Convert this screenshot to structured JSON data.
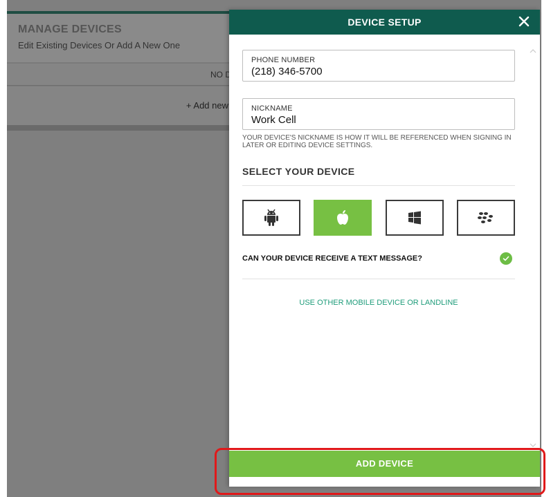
{
  "background": {
    "title": "MANAGE DEVICES",
    "subtitle": "Edit Existing Devices Or Add A New One",
    "no_devices_text": "NO D",
    "add_new_text": "+ Add new"
  },
  "modal": {
    "title": "DEVICE SETUP",
    "close_icon": "close-icon",
    "phone": {
      "label": "PHONE NUMBER",
      "value": "(218) 346-5700"
    },
    "nickname": {
      "label": "NICKNAME",
      "value": "Work Cell"
    },
    "nickname_help": "YOUR DEVICE'S NICKNAME IS HOW IT WILL BE REFERENCED WHEN SIGNING IN LATER OR EDITING DEVICE SETTINGS.",
    "select_title": "SELECT YOUR DEVICE",
    "devices": [
      {
        "icon": "android-icon",
        "selected": false
      },
      {
        "icon": "apple-icon",
        "selected": true
      },
      {
        "icon": "windows-icon",
        "selected": false
      },
      {
        "icon": "blackberry-icon",
        "selected": false
      }
    ],
    "text_question": "CAN YOUR DEVICE RECEIVE A TEXT MESSAGE?",
    "text_question_checked": true,
    "other_link": "USE OTHER MOBILE DEVICE OR LANDLINE",
    "add_button": "ADD DEVICE"
  },
  "colors": {
    "header": "#0f5b4e",
    "accent_green": "#77c043",
    "link": "#1e9c7a",
    "annotation": "#e0191a"
  }
}
